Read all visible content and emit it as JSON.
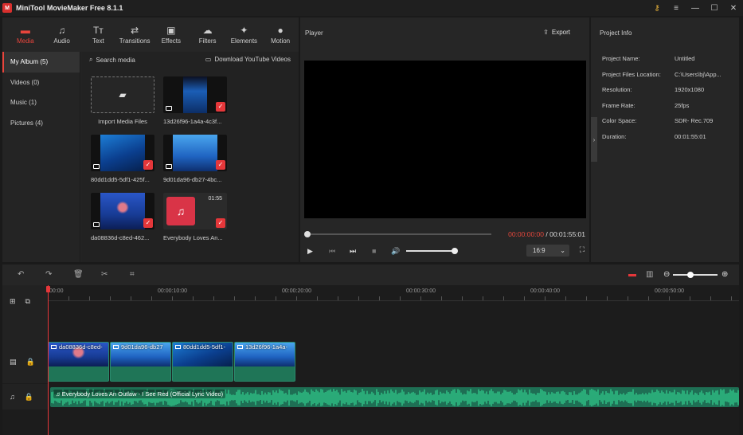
{
  "app": {
    "title": "MiniTool MovieMaker Free 8.1.1",
    "logo_glyph": "M",
    "window_icons": [
      {
        "name": "key-icon",
        "glyph": "⚷"
      },
      {
        "name": "menu-icon",
        "glyph": "≡"
      },
      {
        "name": "minimize-icon",
        "glyph": "—"
      },
      {
        "name": "maximize-icon",
        "glyph": "☐"
      },
      {
        "name": "close-icon",
        "glyph": "✕"
      }
    ]
  },
  "tabs": [
    {
      "name": "media",
      "label": "Media",
      "glyph": "▬",
      "active": true
    },
    {
      "name": "audio",
      "label": "Audio",
      "glyph": "♫",
      "active": false
    },
    {
      "name": "text",
      "label": "Text",
      "glyph": "Tт",
      "active": false
    },
    {
      "name": "transitions",
      "label": "Transitions",
      "glyph": "⇄",
      "active": false
    },
    {
      "name": "effects",
      "label": "Effects",
      "glyph": "▣",
      "active": false
    },
    {
      "name": "filters",
      "label": "Filters",
      "glyph": "☁",
      "active": false
    },
    {
      "name": "elements",
      "label": "Elements",
      "glyph": "✦",
      "active": false
    },
    {
      "name": "motion",
      "label": "Motion",
      "glyph": "●",
      "active": false
    }
  ],
  "sidebar": {
    "items": [
      {
        "label": "My Album (5)",
        "active": true
      },
      {
        "label": "Videos (0)",
        "active": false
      },
      {
        "label": "Music (1)",
        "active": false
      },
      {
        "label": "Pictures (4)",
        "active": false
      }
    ]
  },
  "media": {
    "search_label": "Search media",
    "youtube_label": "Download YouTube Videos",
    "import_label": "Import Media Files",
    "items": [
      {
        "name": "13d26f96-1a4a-4c3f...",
        "thumb": "vthumb",
        "type": "image",
        "checked": true
      },
      {
        "name": "80dd1dd5-5df1-425f...",
        "thumb": "ocean",
        "type": "image",
        "checked": true
      },
      {
        "name": "9d01da96-db27-4bc...",
        "thumb": "ocean2",
        "type": "image",
        "checked": true
      },
      {
        "name": "da08836d-c8ed-462...",
        "thumb": "jelly",
        "type": "image",
        "checked": true
      },
      {
        "name": "Everybody Loves An...",
        "thumb": "music",
        "type": "music",
        "duration": "01:55",
        "checked": true
      }
    ]
  },
  "player": {
    "title": "Player",
    "export_label": "Export",
    "current_time": "00:00:00:00",
    "separator": " / ",
    "total_time": "00:01:55:01",
    "aspect_ratio": "16:9",
    "progress": 0,
    "volume": 1.0
  },
  "project_info": {
    "title": "Project Info",
    "rows": [
      {
        "key": "Project Name:",
        "value": "Untitled"
      },
      {
        "key": "Project Files Location:",
        "value": "C:\\Users\\bj\\App..."
      },
      {
        "key": "Resolution:",
        "value": "1920x1080"
      },
      {
        "key": "Frame Rate:",
        "value": "25fps"
      },
      {
        "key": "Color Space:",
        "value": "SDR- Rec.709"
      },
      {
        "key": "Duration:",
        "value": "00:01:55:01"
      }
    ]
  },
  "timeline": {
    "ruler_labels": [
      "00:00",
      "00:00:10:00",
      "00:00:20:00",
      "00:00:30:00",
      "00:00:40:00",
      "00:00:50:00"
    ],
    "video_clips": [
      {
        "name": "da08836d-c8ed-",
        "thumb": "jelly"
      },
      {
        "name": "9d01da96-db27",
        "thumb": "ocean2"
      },
      {
        "name": "80dd1dd5-5df1-",
        "thumb": "ocean"
      },
      {
        "name": "13d26f96-1a4a-",
        "thumb": "ocean2"
      }
    ],
    "audio_clip": "Everybody Loves An Outlaw - I See Red (Official Lyric Video)",
    "zoom_level": 0.4,
    "colors": {
      "playhead": "#e5373a",
      "audio": "#2fbf84",
      "accent": "#e8453c"
    }
  }
}
